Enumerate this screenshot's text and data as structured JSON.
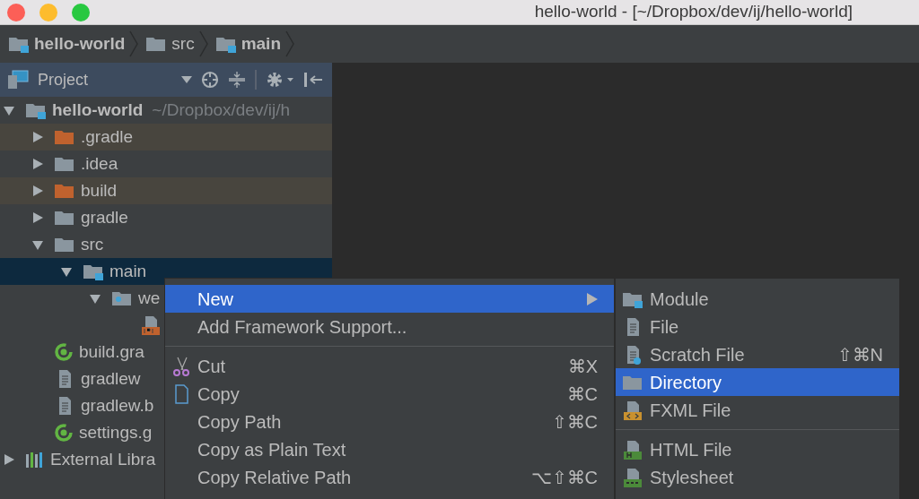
{
  "window": {
    "title": "hello-world - [~/Dropbox/dev/ij/hello-world]"
  },
  "breadcrumbs": [
    {
      "label": "hello-world",
      "kind": "module"
    },
    {
      "label": "src",
      "kind": "folder"
    },
    {
      "label": "main",
      "kind": "module"
    }
  ],
  "project_panel": {
    "title": "Project"
  },
  "tree": [
    {
      "label": "hello-world",
      "path": "~/Dropbox/dev/ij/h",
      "kind": "module",
      "expanded": true,
      "selected": false,
      "children": [
        {
          "label": ".gradle",
          "kind": "excluded",
          "expanded": false,
          "selected": false
        },
        {
          "label": ".idea",
          "kind": "folder",
          "expanded": false,
          "selected": false
        },
        {
          "label": "build",
          "kind": "excluded",
          "expanded": false,
          "selected": false
        },
        {
          "label": "gradle",
          "kind": "folder",
          "expanded": false,
          "selected": false
        },
        {
          "label": "src",
          "kind": "folder",
          "expanded": true,
          "selected": false,
          "children": [
            {
              "label": "main",
              "kind": "module",
              "expanded": true,
              "selected": true,
              "children": [
                {
                  "label": "we",
                  "kind": "web",
                  "expanded": true,
                  "selected": false,
                  "children": [
                    {
                      "kind": "jsp",
                      "selected": false
                    }
                  ]
                }
              ]
            }
          ]
        },
        {
          "label": "build.gra",
          "kind": "gradle",
          "selected": false
        },
        {
          "label": "gradlew",
          "kind": "file",
          "selected": false
        },
        {
          "label": "gradlew.b",
          "kind": "file",
          "selected": false
        },
        {
          "label": "settings.g",
          "kind": "gradle",
          "selected": false
        }
      ]
    },
    {
      "label": "External Libra",
      "kind": "libraries",
      "expanded": false,
      "selected": false
    }
  ],
  "context_menu": {
    "groups": [
      [
        {
          "label": "New",
          "selected": true,
          "submenu": true
        },
        {
          "label": "Add Framework Support...",
          "selected": false
        }
      ],
      [
        {
          "label": "Cut",
          "shortcut": "⌘X",
          "kind": "scissors",
          "selected": false
        },
        {
          "label": "Copy",
          "shortcut": "⌘C",
          "kind": "copy",
          "selected": false
        },
        {
          "label": "Copy Path",
          "shortcut": "⇧⌘C",
          "selected": false
        },
        {
          "label": "Copy as Plain Text",
          "selected": false
        },
        {
          "label": "Copy Relative Path",
          "shortcut": "⌥⇧⌘C",
          "selected": false
        }
      ]
    ]
  },
  "submenu": {
    "groups": [
      [
        {
          "label": "Module",
          "kind": "module",
          "selected": false
        },
        {
          "label": "File",
          "kind": "file",
          "selected": false
        },
        {
          "label": "Scratch File",
          "kind": "scratch",
          "shortcut": "⇧⌘N",
          "selected": false
        },
        {
          "label": "Directory",
          "kind": "folder",
          "selected": true
        },
        {
          "label": "FXML File",
          "kind": "fxml",
          "selected": false
        }
      ],
      [
        {
          "label": "HTML File",
          "kind": "html",
          "selected": false
        },
        {
          "label": "Stylesheet",
          "kind": "css",
          "selected": false
        }
      ]
    ]
  }
}
